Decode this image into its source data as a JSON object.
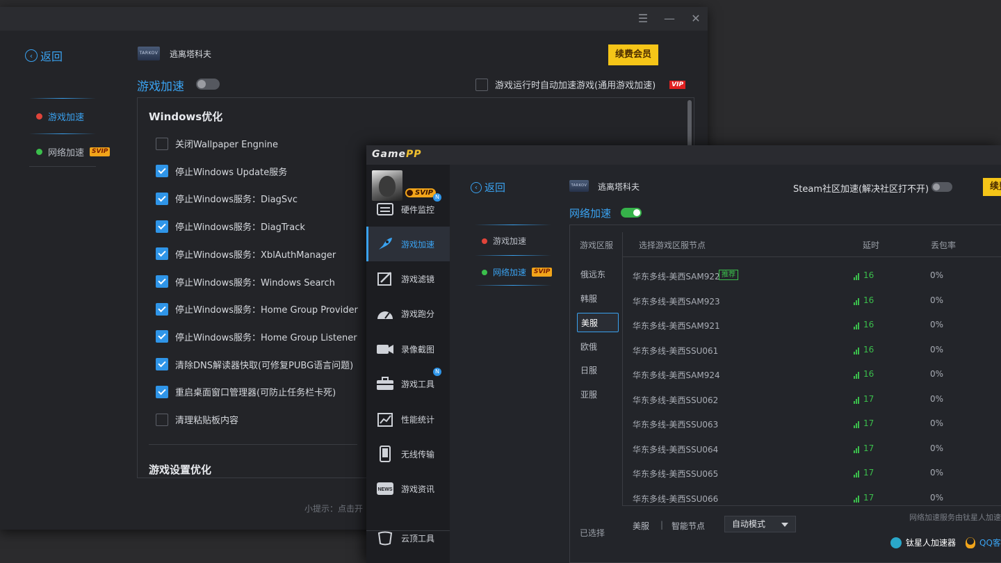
{
  "back_window": {
    "back_label": "返回",
    "game_logo_text": "TARKOV",
    "game_name": "逃离塔科夫",
    "vip_button": "续费会员",
    "section_title": "游戏加速",
    "auto_accel_label": "游戏运行时自动加速游戏(通用游戏加速)",
    "vip_tag": "VIP",
    "side_items": [
      {
        "label": "游戏加速",
        "badge": ""
      },
      {
        "label": "网络加速",
        "badge": "SVIP"
      }
    ],
    "windows_title": "Windows优化",
    "options": [
      {
        "label": "关闭Wallpaper Engnine",
        "checked": false
      },
      {
        "label": "停止Windows Update服务",
        "checked": true
      },
      {
        "label": "停止Windows服务：DiagSvc",
        "checked": true
      },
      {
        "label": "停止Windows服务：DiagTrack",
        "checked": true
      },
      {
        "label": "停止Windows服务：XblAuthManager",
        "checked": true
      },
      {
        "label": "停止Windows服务：Windows Search",
        "checked": true
      },
      {
        "label": "停止Windows服务：Home Group Provider",
        "checked": true
      },
      {
        "label": "停止Windows服务：Home Group Listener",
        "checked": true
      },
      {
        "label": "清除DNS解读器快取(可修复PUBG语言问题)",
        "checked": true
      },
      {
        "label": "重启桌面窗口管理器(可防止任务栏卡死)",
        "checked": true
      },
      {
        "label": "清理粘贴板内容",
        "checked": false
      }
    ],
    "game_settings_title": "游戏设置优化",
    "tip": "小提示：点击开"
  },
  "front_window": {
    "brand_a": "Game",
    "brand_b": "PP",
    "svip_badge": "SVIP",
    "nav": [
      {
        "label": "硬件监控",
        "icon": "hardware-monitor-icon",
        "new": true
      },
      {
        "label": "游戏加速",
        "icon": "rocket-icon",
        "new": false,
        "active": true
      },
      {
        "label": "游戏滤镜",
        "icon": "filter-icon",
        "new": false
      },
      {
        "label": "游戏跑分",
        "icon": "speedometer-icon",
        "new": false
      },
      {
        "label": "录像截图",
        "icon": "camera-icon",
        "new": false
      },
      {
        "label": "游戏工具",
        "icon": "toolbox-icon",
        "new": true
      },
      {
        "label": "性能统计",
        "icon": "chart-icon",
        "new": false
      },
      {
        "label": "无线传输",
        "icon": "phone-icon",
        "new": false
      },
      {
        "label": "游戏资讯",
        "icon": "news-icon",
        "new": false
      },
      {
        "label": "云顶工具",
        "icon": "mask-icon",
        "new": false
      }
    ],
    "new_badge": "N",
    "back_label": "返回",
    "game_logo_text": "TARKOV",
    "game_name": "逃离塔科夫",
    "steam_label": "Steam社区加速(解决社区打不开)",
    "vip_button_partial": "续费",
    "section_title": "网络加速",
    "side_items": [
      {
        "label": "游戏加速",
        "badge": ""
      },
      {
        "label": "网络加速",
        "badge": "SVIP"
      }
    ],
    "table": {
      "headers": {
        "region": "游戏区服",
        "node": "选择游戏区服节点",
        "latency": "延时",
        "loss": "丢包率"
      },
      "regions": [
        "俄远东",
        "韩服",
        "美服",
        "欧俄",
        "日服",
        "亚服"
      ],
      "selected_region": "美服",
      "rows": [
        {
          "node": "华东多线-美西SAM922",
          "tag": "推荐",
          "latency": "16",
          "loss": "0%"
        },
        {
          "node": "华东多线-美西SAM923",
          "tag": "",
          "latency": "16",
          "loss": "0%"
        },
        {
          "node": "华东多线-美西SAM921",
          "tag": "",
          "latency": "16",
          "loss": "0%"
        },
        {
          "node": "华东多线-美西SSU061",
          "tag": "",
          "latency": "16",
          "loss": "0%"
        },
        {
          "node": "华东多线-美西SAM924",
          "tag": "",
          "latency": "16",
          "loss": "0%"
        },
        {
          "node": "华东多线-美西SSU062",
          "tag": "",
          "latency": "17",
          "loss": "0%"
        },
        {
          "node": "华东多线-美西SSU063",
          "tag": "",
          "latency": "17",
          "loss": "0%"
        },
        {
          "node": "华东多线-美西SSU064",
          "tag": "",
          "latency": "17",
          "loss": "0%"
        },
        {
          "node": "华东多线-美西SSU065",
          "tag": "",
          "latency": "17",
          "loss": "0%"
        },
        {
          "node": "华东多线-美西SSU066",
          "tag": "",
          "latency": "17",
          "loss": "0%"
        }
      ]
    },
    "footer": {
      "selected_label": "已选择",
      "selected_region": "美服",
      "divider": "|",
      "smart_node": "智能节点",
      "mode": "自动模式",
      "service_note": "网络加速服务由钛星人加速",
      "partner": "钛星人加速器",
      "qq": "QQ客服"
    }
  },
  "colors": {
    "accent": "#3aa2f0",
    "vip_yellow": "#f5c518",
    "green": "#3bbf4c",
    "red": "#e0443a"
  }
}
